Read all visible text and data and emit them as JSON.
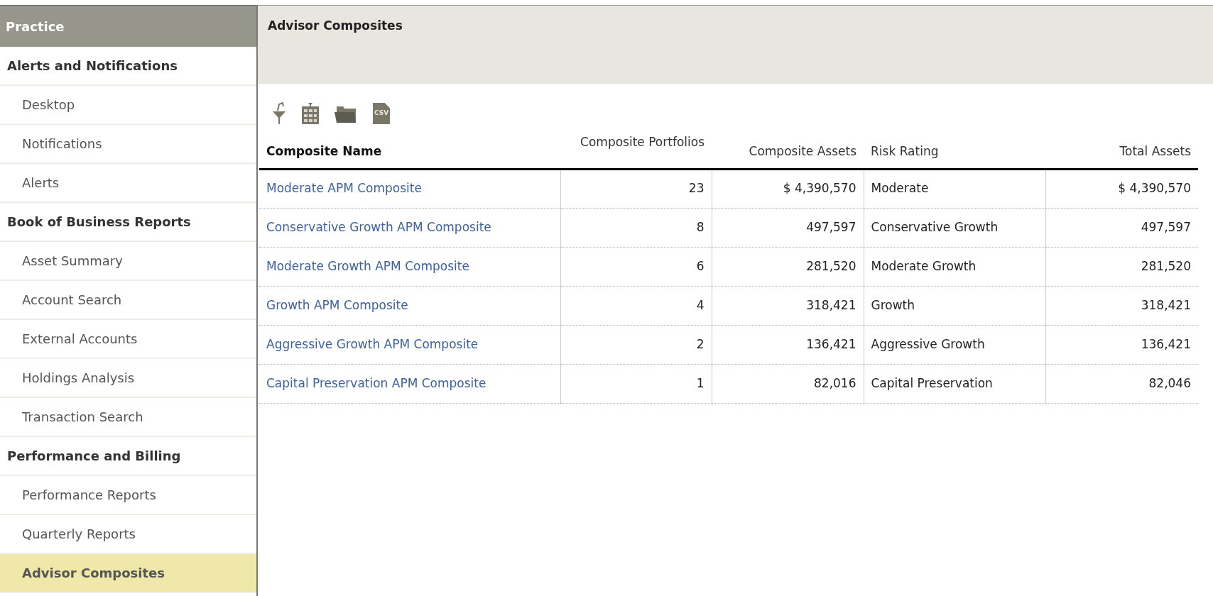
{
  "sidebar": {
    "title": "Practice",
    "items": [
      {
        "kind": "section",
        "label": "Alerts and Notifications",
        "selected": false
      },
      {
        "kind": "item",
        "label": "Desktop",
        "selected": false
      },
      {
        "kind": "item",
        "label": "Notifications",
        "selected": false
      },
      {
        "kind": "item",
        "label": "Alerts",
        "selected": false
      },
      {
        "kind": "section",
        "label": "Book of Business Reports",
        "selected": false
      },
      {
        "kind": "item",
        "label": "Asset Summary",
        "selected": false
      },
      {
        "kind": "item",
        "label": "Account Search",
        "selected": false
      },
      {
        "kind": "item",
        "label": "External Accounts",
        "selected": false
      },
      {
        "kind": "item",
        "label": "Holdings Analysis",
        "selected": false
      },
      {
        "kind": "item",
        "label": "Transaction Search",
        "selected": false
      },
      {
        "kind": "section",
        "label": "Performance and Billing",
        "selected": false
      },
      {
        "kind": "item",
        "label": "Performance Reports",
        "selected": false
      },
      {
        "kind": "item",
        "label": "Quarterly Reports",
        "selected": false
      },
      {
        "kind": "item",
        "label": "Advisor Composites",
        "selected": true
      }
    ]
  },
  "page": {
    "title": "Advisor Composites",
    "toolbar": [
      {
        "kind": "filter"
      },
      {
        "kind": "columns"
      },
      {
        "kind": "folder"
      },
      {
        "kind": "csv",
        "label": "CSV"
      }
    ]
  },
  "table": {
    "columns": [
      "Composite Name",
      "Composite Portfolios",
      "Composite Assets",
      "Risk Rating",
      "Total Assets"
    ],
    "rows": [
      [
        "Moderate APM Composite",
        "23",
        "$ 4,390,570",
        "Moderate",
        "$ 4,390,570"
      ],
      [
        "Conservative Growth APM Composite",
        "8",
        "497,597",
        "Conservative Growth",
        "497,597"
      ],
      [
        "Moderate Growth APM Composite",
        "6",
        "281,520",
        "Moderate Growth",
        "281,520"
      ],
      [
        "Growth APM Composite",
        "4",
        "318,421",
        "Growth",
        "318,421"
      ],
      [
        "Aggressive Growth APM Composite",
        "2",
        "136,421",
        "Aggressive Growth",
        "136,421"
      ],
      [
        "Capital Preservation APM Composite",
        "1",
        "82,016",
        "Capital Preservation",
        "82,046"
      ]
    ]
  }
}
